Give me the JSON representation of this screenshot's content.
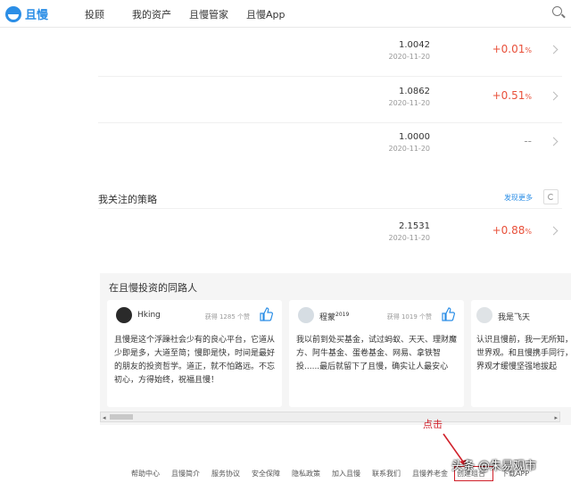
{
  "nav": {
    "logo_text": "且慢",
    "links": [
      "投顾",
      "我的资产",
      "且慢管家",
      "且慢App"
    ]
  },
  "funds": [
    {
      "value": "1.0042",
      "date": "2020-11-20",
      "change": "+0.01",
      "unit": "%"
    },
    {
      "value": "1.0862",
      "date": "2020-11-20",
      "change": "+0.51",
      "unit": "%"
    },
    {
      "value": "1.0000",
      "date": "2020-11-20",
      "change": "--",
      "unit": ""
    }
  ],
  "strategies": {
    "title": "我关注的策略",
    "discover_label": "发现更多",
    "items": [
      {
        "value": "2.1531",
        "date": "2020-11-20",
        "change": "+0.88",
        "unit": "%"
      }
    ]
  },
  "peers": {
    "title": "在且慢投资的同路人",
    "cards": [
      {
        "name": "Hking",
        "sup": "",
        "likes": "获得 1285 个赞",
        "text": "且慢是这个浮躁社会少有的良心平台，它道从少即是多，大道至简；慢即是快，时间是最好的朋友的投资哲学。道正，就不怕路远。不忘初心，方得始终，祝福且慢！",
        "avatar_color": "#2a2a2a"
      },
      {
        "name": "程蒙",
        "sup": "2019",
        "likes": "获得 1019 个赞",
        "text": "我以前到处买基金，试过蚂蚁、天天、理财魔方、阿牛基金、蛋卷基金、网易、拿铁智投......最后就留下了且慢，确实让人最安心",
        "avatar_color": "#d6dde3"
      },
      {
        "name": "我是飞天",
        "sup": "",
        "likes": "",
        "text": "认识且慢前，我一无所知，世界观。和且慢携手同行，界观才缓慢坚强地拔起",
        "avatar_color": "#dfe3e6"
      }
    ]
  },
  "annotation": "点击",
  "footer": {
    "links": [
      "帮助中心",
      "且慢简介",
      "服务协议",
      "安全保障",
      "隐私政策",
      "加入且慢",
      "联系我们",
      "且慢养老金",
      "创建组合",
      "下载APP"
    ]
  },
  "watermark": "头条 @朱易观市",
  "colors": {
    "accent": "#2b8ee6",
    "up": "#e8503a",
    "annotation": "#d0202a"
  }
}
